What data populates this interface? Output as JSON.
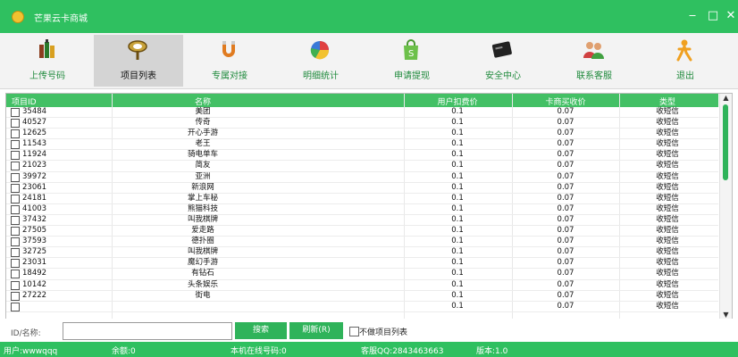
{
  "window": {
    "title": "芒果云卡商城",
    "minimize": "‒",
    "maximize": "□",
    "close": "✕"
  },
  "toolbar": [
    {
      "label": "上传号码",
      "icon": "bottles-icon",
      "active": false
    },
    {
      "label": "项目列表",
      "icon": "magnifier-icon",
      "active": true
    },
    {
      "label": "专属对接",
      "icon": "magnet-icon",
      "active": false
    },
    {
      "label": "明细统计",
      "icon": "pie-chart-icon",
      "active": false
    },
    {
      "label": "申请提现",
      "icon": "shopping-bag-icon",
      "active": false
    },
    {
      "label": "安全中心",
      "icon": "card-icon",
      "active": false
    },
    {
      "label": "联系客服",
      "icon": "people-icon",
      "active": false
    },
    {
      "label": "退出",
      "icon": "exit-icon",
      "active": false
    }
  ],
  "grid": {
    "columns": [
      "项目ID",
      "名称",
      "用户扣费价",
      "卡商买收价",
      "类型"
    ],
    "rows": [
      [
        "35484",
        "美团",
        "0.1",
        "0.07",
        "收短信"
      ],
      [
        "40527",
        "传奇",
        "0.1",
        "0.07",
        "收短信"
      ],
      [
        "12625",
        "开心手游",
        "0.1",
        "0.07",
        "收短信"
      ],
      [
        "11543",
        "老王",
        "0.1",
        "0.07",
        "收短信"
      ],
      [
        "11924",
        "骑电单车",
        "0.1",
        "0.07",
        "收短信"
      ],
      [
        "21023",
        "简友",
        "0.1",
        "0.07",
        "收短信"
      ],
      [
        "39972",
        "亚洲",
        "0.1",
        "0.07",
        "收短信"
      ],
      [
        "23061",
        "新浪网",
        "0.1",
        "0.07",
        "收短信"
      ],
      [
        "24181",
        "掌上车秘",
        "0.1",
        "0.07",
        "收短信"
      ],
      [
        "41003",
        "熊猫科技",
        "0.1",
        "0.07",
        "收短信"
      ],
      [
        "37432",
        "叫我棋牌",
        "0.1",
        "0.07",
        "收短信"
      ],
      [
        "27505",
        "爱走路",
        "0.1",
        "0.07",
        "收短信"
      ],
      [
        "37593",
        "德扑圈",
        "0.1",
        "0.07",
        "收短信"
      ],
      [
        "32725",
        "叫我棋牌",
        "0.1",
        "0.07",
        "收短信"
      ],
      [
        "23031",
        "魔幻手游",
        "0.1",
        "0.07",
        "收短信"
      ],
      [
        "18492",
        "有钻石",
        "0.1",
        "0.07",
        "收短信"
      ],
      [
        "10142",
        "头条娱乐",
        "0.1",
        "0.07",
        "收短信"
      ],
      [
        "27222",
        "街电",
        "0.1",
        "0.07",
        "收短信"
      ],
      [
        "",
        "",
        "0.1",
        "0.07",
        "收短信"
      ]
    ]
  },
  "search": {
    "label": "ID/名称:",
    "value": "",
    "search_button": "搜索",
    "refresh_button": "刷新(R)",
    "checkbox_label": "不做项目列表"
  },
  "status": {
    "user": "用户:wwwqqq",
    "balance": "余额:0",
    "online_numbers": "本机在线号码:0",
    "service": "客服QQ:2843463663",
    "version": "版本:1.0"
  },
  "colors": {
    "accent": "#2fc060",
    "header": "#43c065"
  }
}
